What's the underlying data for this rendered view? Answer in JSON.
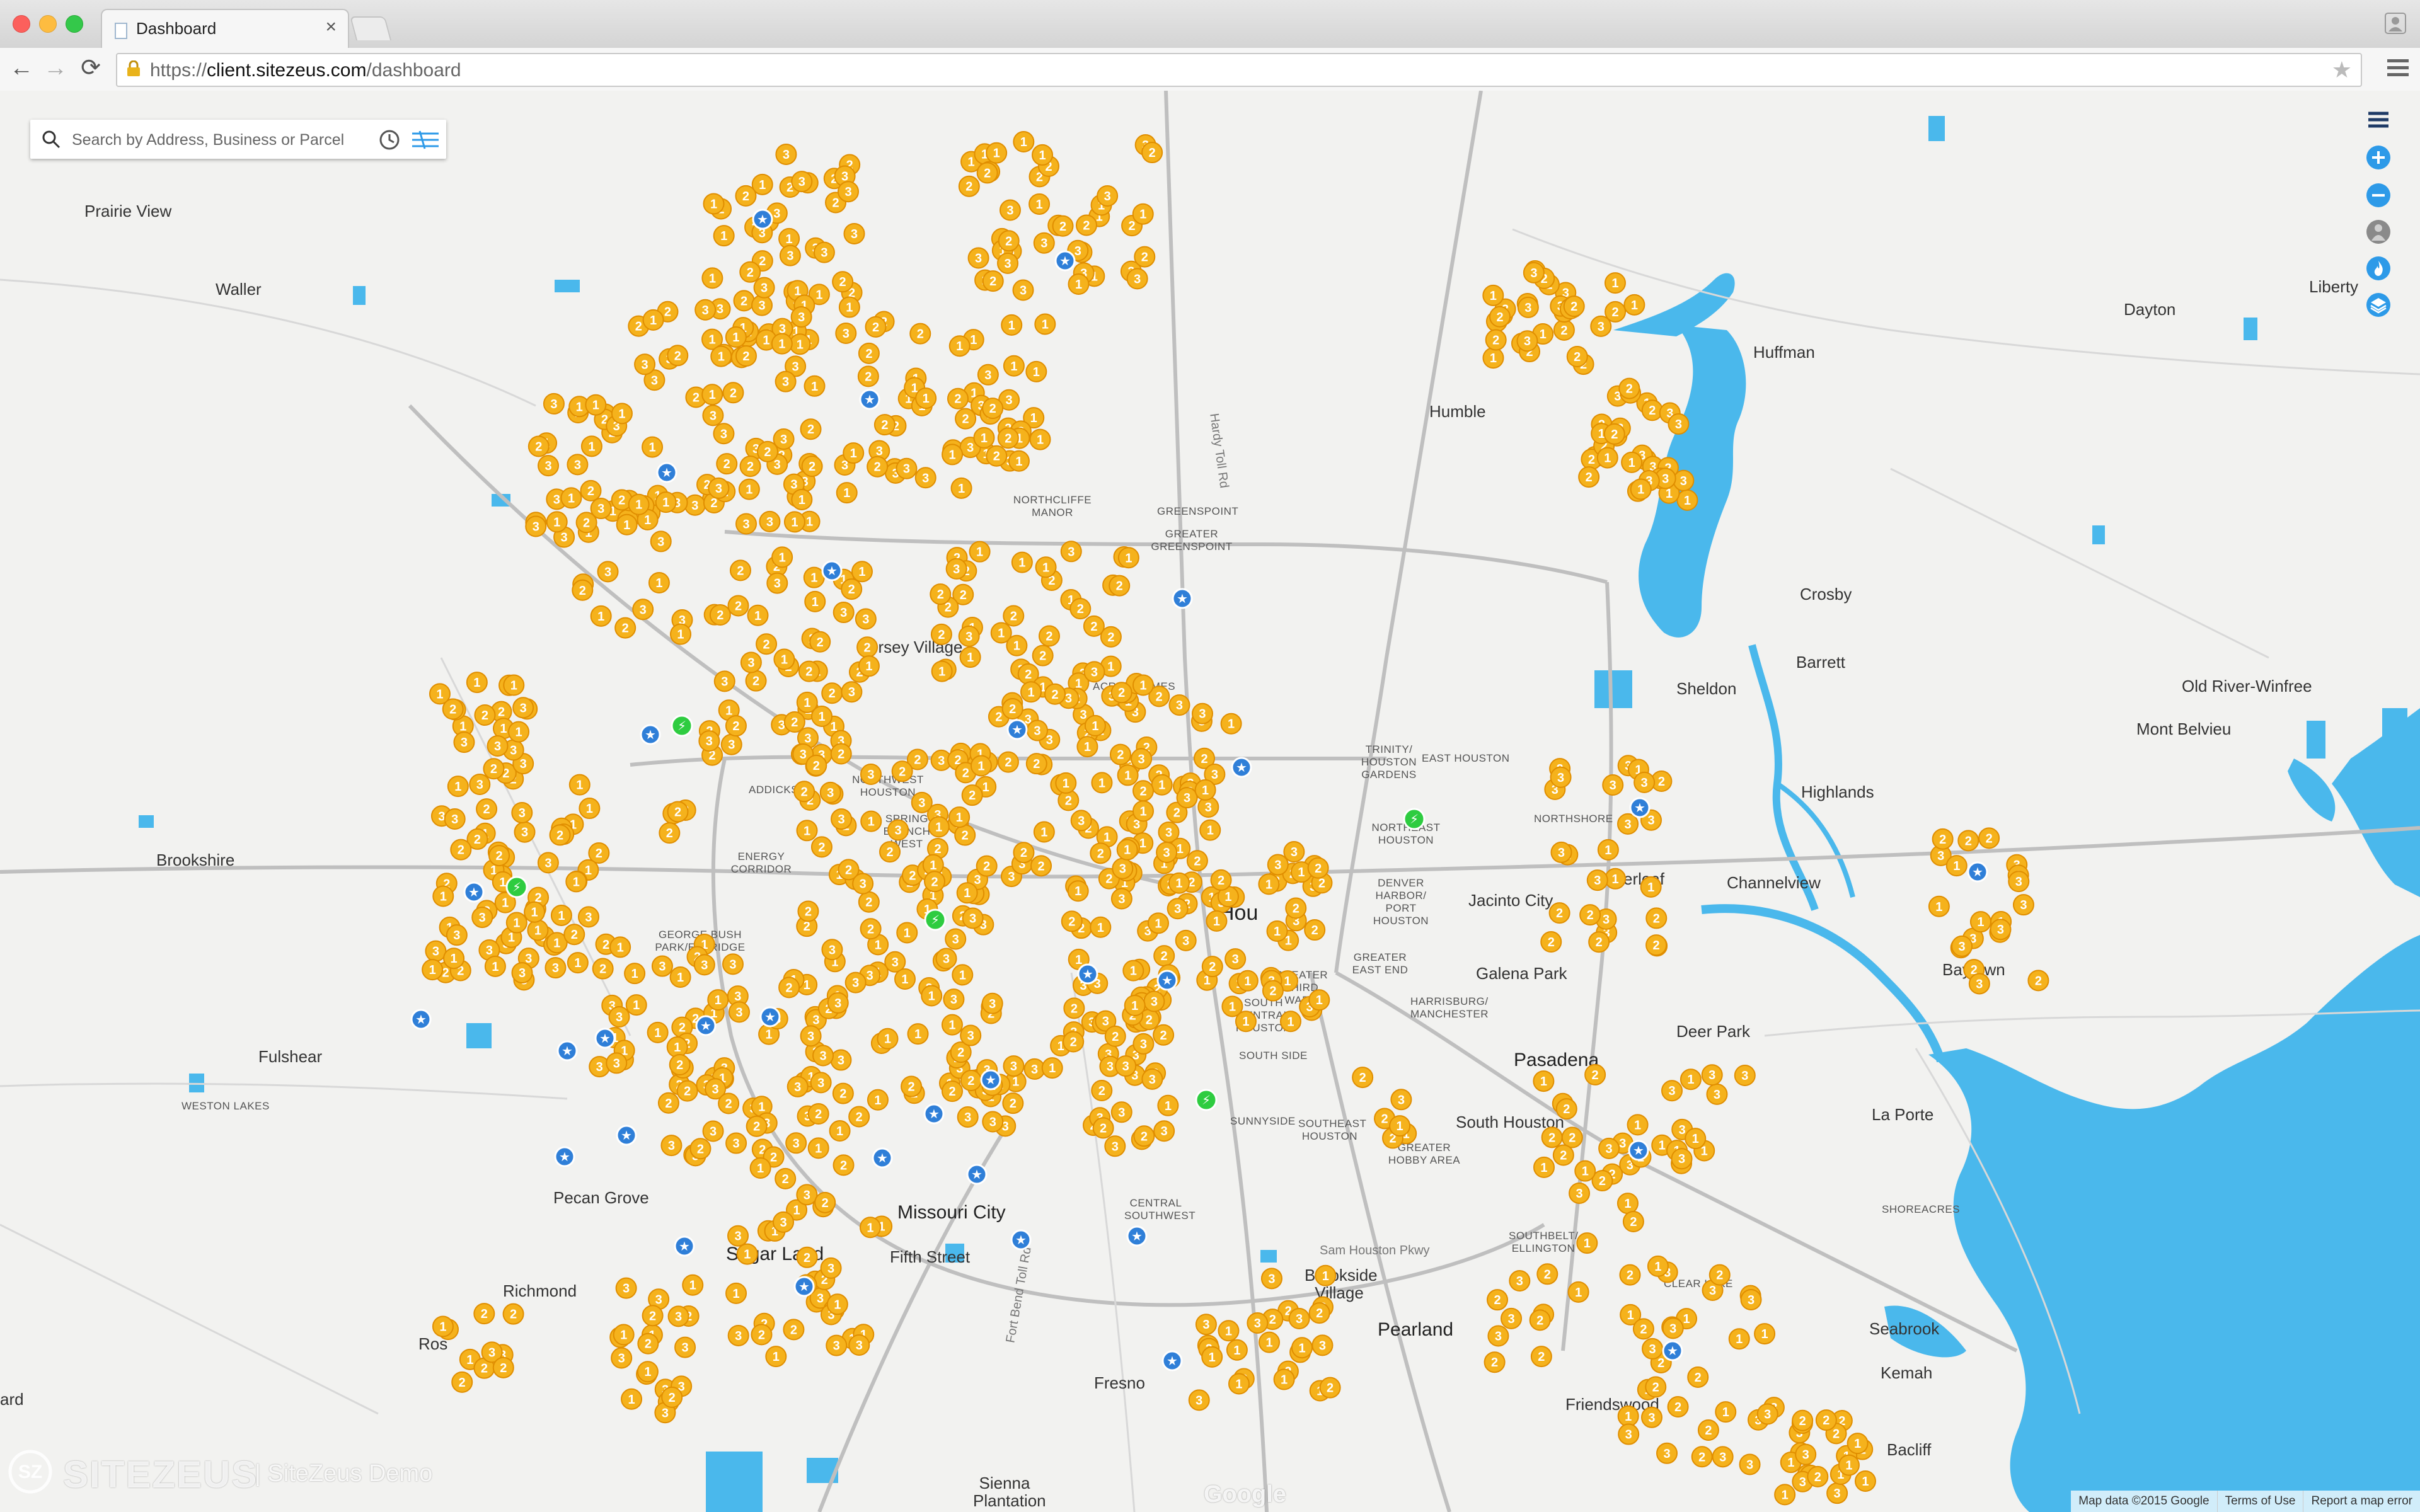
{
  "browser": {
    "tab_title": "Dashboard",
    "tab_close": "×",
    "url_scheme": "https://",
    "url_host": "client.sitezeus.com",
    "url_path": "/dashboard",
    "back_glyph": "←",
    "forward_glyph": "→",
    "reload_glyph": "⟳",
    "star_glyph": "★",
    "traffic_colors": [
      "#fc605c",
      "#fdbc40",
      "#34c84a"
    ]
  },
  "search": {
    "placeholder": "Search by Address, Business or Parcel",
    "icons": [
      "search-icon",
      "clock-icon",
      "filter-icon"
    ]
  },
  "map_controls": [
    "menu-icon",
    "zoom-in-icon",
    "zoom-out-icon",
    "street-view-icon",
    "heatmap-icon",
    "layers-icon"
  ],
  "colors": {
    "marker_fill": "#f5b21c",
    "marker_stroke": "#e08e00",
    "store_marker": "#2f7fd8",
    "green_marker": "#2ecc40",
    "water": "#4ab8ec",
    "control_blue": "#2d9ae8"
  },
  "place_labels": {
    "prairie_view": "Prairie View",
    "waller": "Waller",
    "huffman": "Huffman",
    "dayton": "Dayton",
    "liberty": "Liberty",
    "humble": "Humble",
    "northcliffe": "NORTHCLIFFE MANOR",
    "greenspoint": "GREENSPOINT",
    "greater_greenspoint": "GREATER GREENSPOINT",
    "crosby": "Crosby",
    "barrett": "Barrett",
    "sheldon": "Sheldon",
    "old_river": "Old River-Winfree",
    "mont_belvieu": "Mont Belvieu",
    "jersey_village": "Jersey Village",
    "acres_homes": "ACRES HOMES",
    "trinity": "TRINITY/ HOUSTON GARDENS",
    "east_houston": "EAST HOUSTON",
    "highlands": "Highlands",
    "addicks": "ADDICKS",
    "northwest_houston": "NORTHWEST HOUSTON",
    "spring_branch": "SPRING BRANCH WEST",
    "northeast_houston": "NORTHEAST HOUSTON",
    "northshore": "NORTHSHORE",
    "brookshire": "Brookshire",
    "energy_corridor": "ENERGY CORRIDOR",
    "jacinto_city": "Jacinto City",
    "cloverleaf": "Cloverleaf",
    "channelview": "Channelview",
    "george_bush": "GEORGE BUSH PARK/ELDRIDGE",
    "denver_harbor": "DENVER HARBOR/ PORT HOUSTON",
    "houston": "Hou",
    "greater_east_end": "GREATER EAST END",
    "galena_park": "Galena Park",
    "baytown": "Baytown",
    "greater_third_ward": "GREATER THIRD WARD",
    "south_central": "SOUTH CENTRAL HOUSTON",
    "harrisburg": "HARRISBURG/ MANCHESTER",
    "fulshear": "Fulshear",
    "deer_park": "Deer Park",
    "pasadena": "Pasadena",
    "weston_lakes": "WESTON LAKES",
    "south_side": "SOUTH SIDE",
    "south_houston": "South Houston",
    "la_porte": "La Porte",
    "sunnyside": "SUNNYSIDE",
    "southeast_houston": "SOUTHEAST HOUSTON",
    "greater_hobby": "GREATER HOBBY AREA",
    "central_southwest": "CENTRAL SOUTHWEST",
    "pecan_grove": "Pecan Grove",
    "missouri_city": "Missouri City",
    "sugar_land": "Sugar Land",
    "shoreacres": "SHOREACRES",
    "fifth_street": "Fifth Street",
    "brookside": "Brookside Village",
    "southbelt": "SOUTHBELT/ ELLINGTON",
    "clear_lake": "CLEAR LAKE",
    "richmond": "Richmond",
    "pearland": "Pearland",
    "seabrook": "Seabrook",
    "kemah": "Kemah",
    "rosenberg": "Ros",
    "fresno": "Fresno",
    "friendswood": "Friendswood",
    "bacliff": "Bacliff",
    "sienna": "Sienna Plantation",
    "ard": "ard",
    "sam_houston_pkwy": "Sam Houston Pkwy",
    "hardy_toll": "Hardy Toll Rd",
    "fort_bend_toll": "Fort Bend Toll Rd"
  },
  "branding": {
    "logo_text": "SITEZEUS",
    "subtitle": "| SiteZeus Demo",
    "google": "Google"
  },
  "attribution": {
    "map_data": "Map data ©2015 Google",
    "terms": "Terms of Use",
    "report": "Report a map error"
  }
}
